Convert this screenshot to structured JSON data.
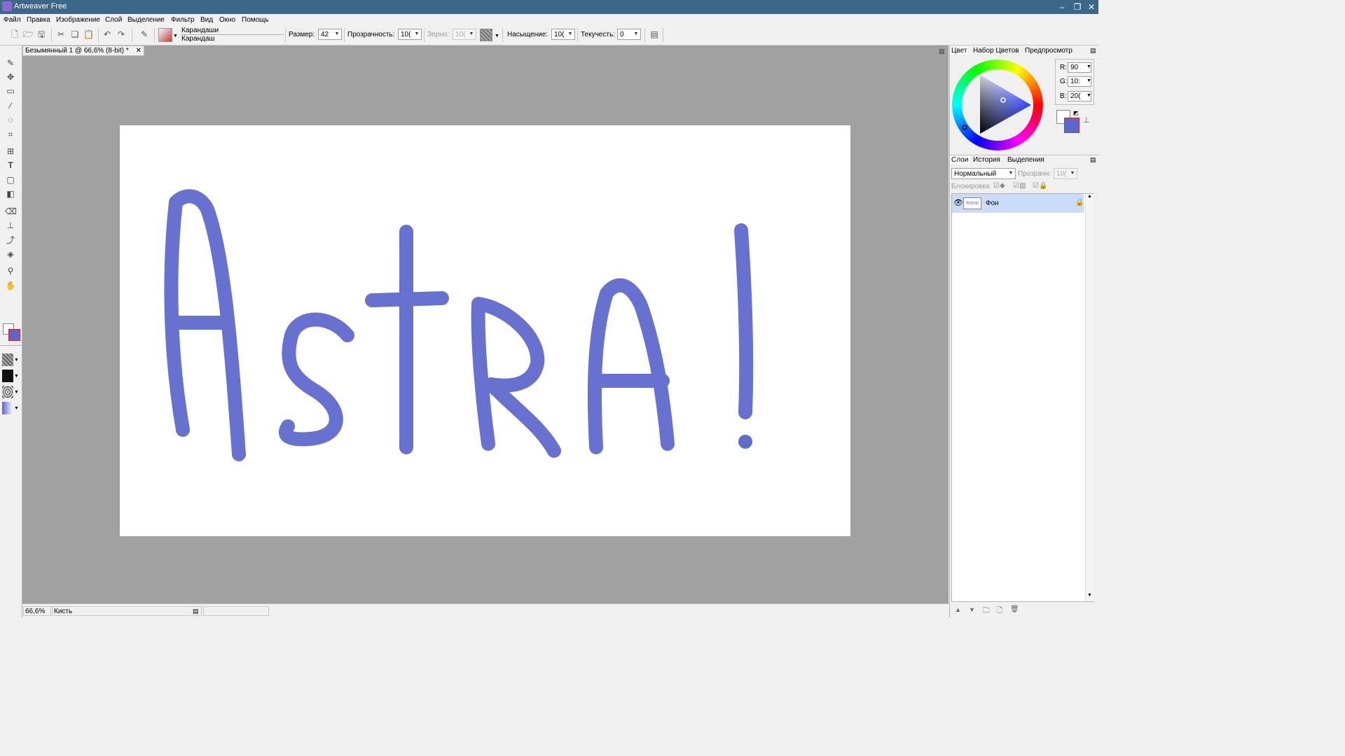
{
  "window": {
    "title": "Artweaver Free",
    "minimize": "–",
    "restore": "❐",
    "close": "✕"
  },
  "menu": [
    "Файл",
    "Правка",
    "Изображение",
    "Слой",
    "Выделение",
    "Фильтр",
    "Вид",
    "Окно",
    "Помощь"
  ],
  "toolbar": {
    "brush_category": "Карандаши",
    "brush_name": "Карандаш",
    "size_label": "Размер:",
    "size_value": "42",
    "opacity_label": "Прозрачность:",
    "opacity_value": "10(",
    "grain_label": "Зерно:",
    "grain_value": "10(",
    "saturation_label": "Насыщение:",
    "saturation_value": "10(",
    "flow_label": "Текучесть:",
    "flow_value": "0"
  },
  "document": {
    "tab_title": "Безымянный 1 @ 66,6% (8-bit) *",
    "canvas_text": "Astra!",
    "stroke_color": "#5f6acd"
  },
  "status": {
    "zoom": "66,6%",
    "tool": "Кисть"
  },
  "color_panel": {
    "tabs": [
      "Цвет",
      "Набор Цветов",
      "Предпросмотр"
    ],
    "r_label": "R:",
    "r_value": "90",
    "g_label": "G:",
    "g_value": "10:",
    "b_label": "B:",
    "b_value": "20(",
    "foreground": "#5a66cc",
    "background": "#ffffff"
  },
  "layers_panel": {
    "tabs": [
      "Слои",
      "История",
      "Выделения"
    ],
    "blend_mode": "Нормальный",
    "opacity_label": "Прозрачн:",
    "opacity_value": "10(",
    "lock_label": "Блокировка",
    "layers": [
      {
        "name": "Фон",
        "thumb": "Astra!"
      }
    ]
  }
}
